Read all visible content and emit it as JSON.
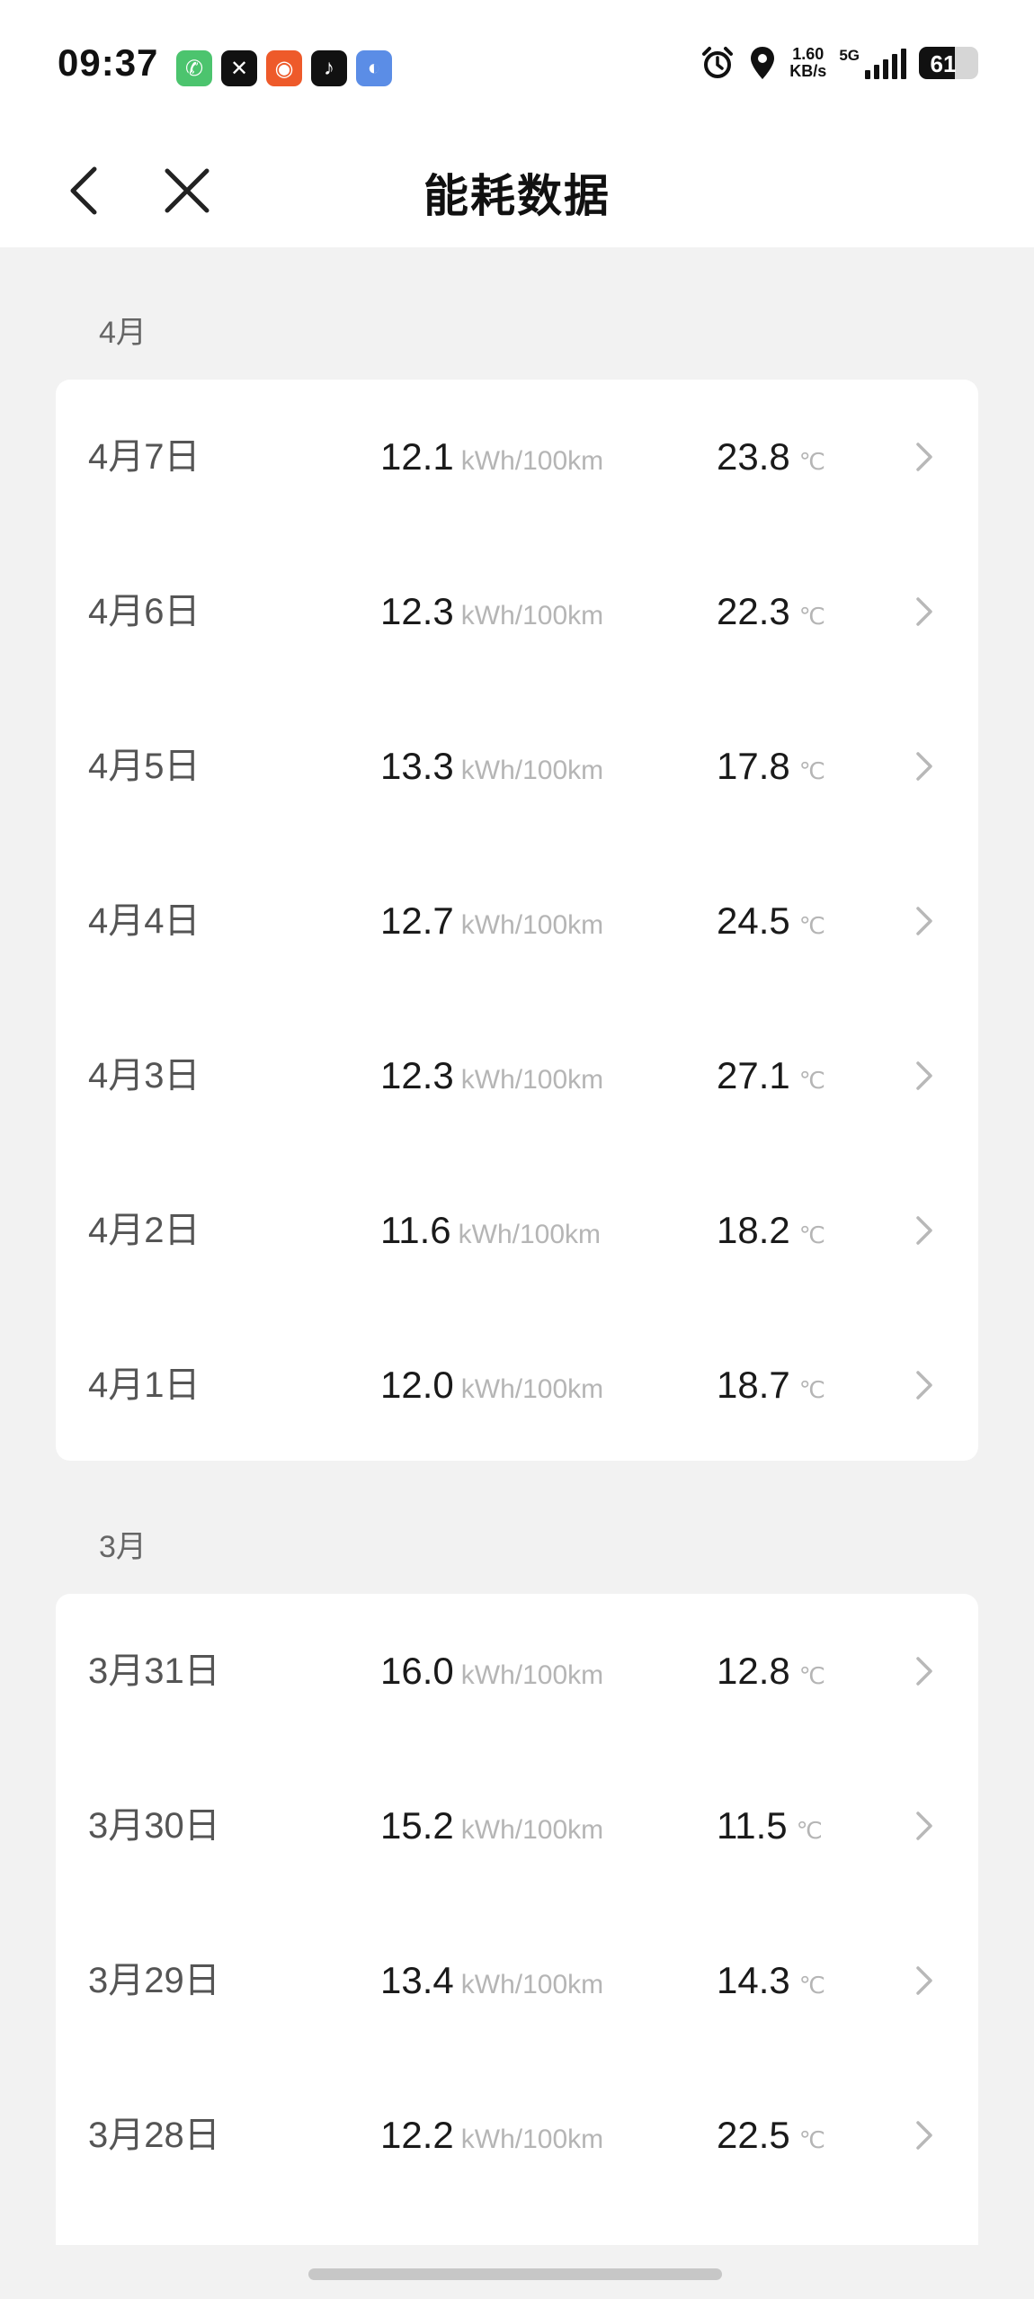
{
  "status_bar": {
    "time": "09:37",
    "notification_icons": [
      {
        "name": "phone-app-icon",
        "color": "#4cc46e",
        "glyph": "✆"
      },
      {
        "name": "capcut-app-icon",
        "color": "#111111",
        "glyph": "✕"
      },
      {
        "name": "kuaishou-app-icon",
        "color": "#ee5a2a",
        "glyph": "◉"
      },
      {
        "name": "tiktok-app-icon",
        "color": "#111111",
        "glyph": "♪"
      },
      {
        "name": "weather-app-icon",
        "color": "#5b8de6",
        "glyph": "◐"
      }
    ],
    "speed_value": "1.60",
    "speed_unit": "KB/s",
    "network": "5G",
    "battery": "61",
    "battery_level": 0.61
  },
  "header": {
    "title": "能耗数据"
  },
  "sections": [
    {
      "label": "4月",
      "rows": [
        {
          "date": "4月7日",
          "energy": "12.1",
          "energy_unit": "kWh/100km",
          "temp": "23.8",
          "temp_unit": "℃"
        },
        {
          "date": "4月6日",
          "energy": "12.3",
          "energy_unit": "kWh/100km",
          "temp": "22.3",
          "temp_unit": "℃"
        },
        {
          "date": "4月5日",
          "energy": "13.3",
          "energy_unit": "kWh/100km",
          "temp": "17.8",
          "temp_unit": "℃"
        },
        {
          "date": "4月4日",
          "energy": "12.7",
          "energy_unit": "kWh/100km",
          "temp": "24.5",
          "temp_unit": "℃"
        },
        {
          "date": "4月3日",
          "energy": "12.3",
          "energy_unit": "kWh/100km",
          "temp": "27.1",
          "temp_unit": "℃"
        },
        {
          "date": "4月2日",
          "energy": "11.6",
          "energy_unit": "kWh/100km",
          "temp": "18.2",
          "temp_unit": "℃"
        },
        {
          "date": "4月1日",
          "energy": "12.0",
          "energy_unit": "kWh/100km",
          "temp": "18.7",
          "temp_unit": "℃"
        }
      ]
    },
    {
      "label": "3月",
      "rows": [
        {
          "date": "3月31日",
          "energy": "16.0",
          "energy_unit": "kWh/100km",
          "temp": "12.8",
          "temp_unit": "℃"
        },
        {
          "date": "3月30日",
          "energy": "15.2",
          "energy_unit": "kWh/100km",
          "temp": "11.5",
          "temp_unit": "℃"
        },
        {
          "date": "3月29日",
          "energy": "13.4",
          "energy_unit": "kWh/100km",
          "temp": "14.3",
          "temp_unit": "℃"
        },
        {
          "date": "3月28日",
          "energy": "12.2",
          "energy_unit": "kWh/100km",
          "temp": "22.5",
          "temp_unit": "℃"
        }
      ]
    }
  ]
}
